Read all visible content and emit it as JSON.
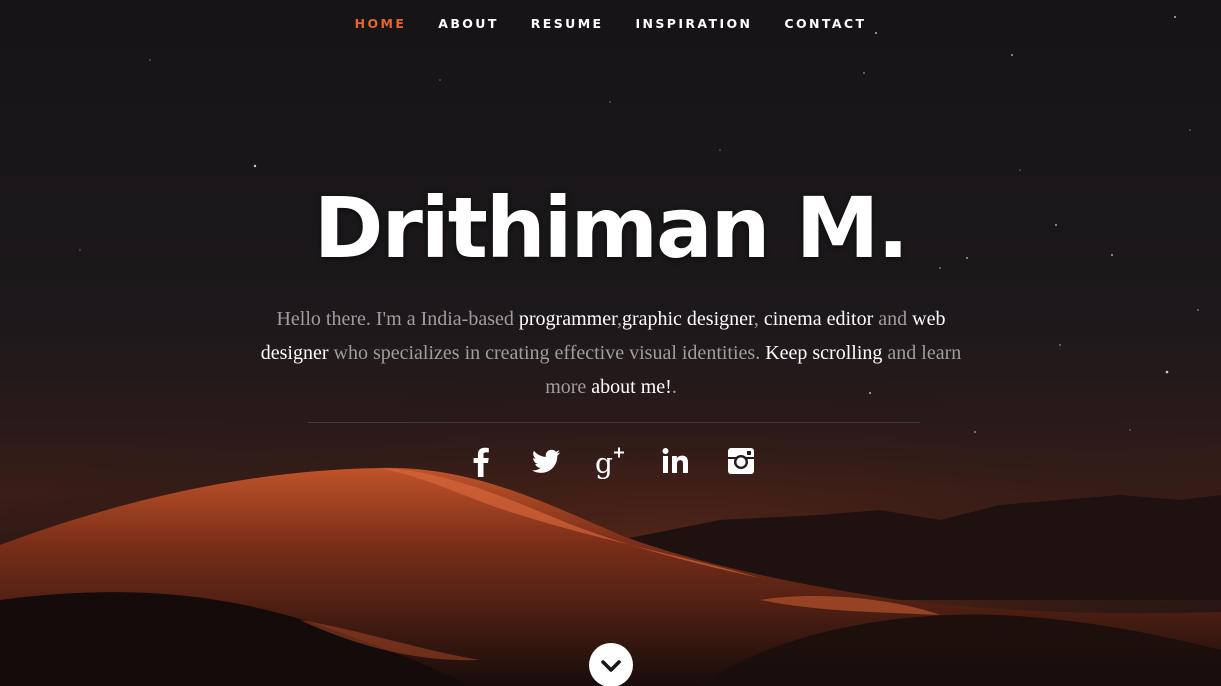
{
  "nav": {
    "items": [
      {
        "label": "HOME",
        "active": true
      },
      {
        "label": "ABOUT",
        "active": false
      },
      {
        "label": "RESUME",
        "active": false
      },
      {
        "label": "INSPIRATION",
        "active": false
      },
      {
        "label": "CONTACT",
        "active": false
      }
    ],
    "active_color": "#e8642c"
  },
  "hero": {
    "title": "Drithiman M.",
    "intro": {
      "p1": "Hello there. I'm a India-based ",
      "l1": "programmer",
      "p2": ",",
      "l2": "graphic designer",
      "p3": ", ",
      "l3": "cinema editor",
      "p4": " and ",
      "l4": "web designer",
      "p5": " who specializes in creating effective visual identities. ",
      "l5": "Keep scrolling",
      "p6": " and learn more ",
      "l6": "about me!",
      "p7": "."
    }
  },
  "social": [
    {
      "icon": "facebook-icon"
    },
    {
      "icon": "twitter-icon"
    },
    {
      "icon": "google-plus-icon"
    },
    {
      "icon": "linkedin-icon"
    },
    {
      "icon": "instagram-icon"
    }
  ],
  "scroll_button": {
    "icon": "chevron-down-icon"
  }
}
